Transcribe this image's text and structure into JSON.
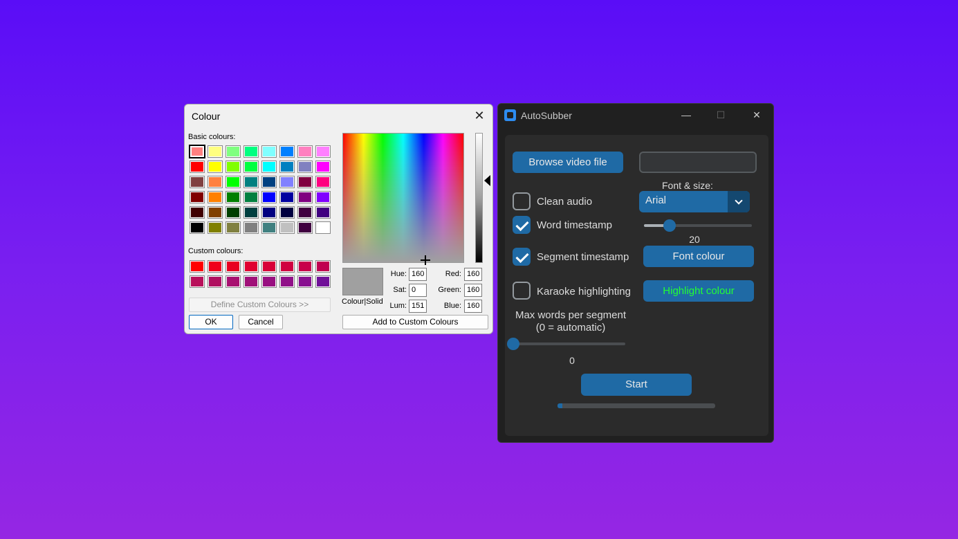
{
  "colour_dialog": {
    "title": "Colour",
    "basic_label": "Basic colours:",
    "custom_label": "Custom colours:",
    "basic_colours": [
      "#ff8080",
      "#ffff80",
      "#80ff80",
      "#00ff80",
      "#80ffff",
      "#0080ff",
      "#ff80c0",
      "#ff80ff",
      "#ff0000",
      "#ffff00",
      "#80ff00",
      "#00ff40",
      "#00ffff",
      "#0080c0",
      "#8080c0",
      "#ff00ff",
      "#804040",
      "#ff8040",
      "#00ff00",
      "#008080",
      "#004080",
      "#8080ff",
      "#800040",
      "#ff0080",
      "#800000",
      "#ff8000",
      "#008000",
      "#008040",
      "#0000ff",
      "#0000a0",
      "#800080",
      "#8000ff",
      "#400000",
      "#804000",
      "#004000",
      "#004040",
      "#000080",
      "#000040",
      "#400040",
      "#400080",
      "#000000",
      "#808000",
      "#808040",
      "#808080",
      "#408080",
      "#c0c0c0",
      "#400040",
      "#ffffff"
    ],
    "custom_colours": [
      "#ff0000",
      "#f0001a",
      "#e80020",
      "#e00030",
      "#d80038",
      "#d00040",
      "#c8004a",
      "#c00050",
      "#b8105a",
      "#b01060",
      "#a81070",
      "#a01078",
      "#981080",
      "#901088",
      "#881090",
      "#701098"
    ],
    "define_custom": "Define Custom Colours >>",
    "ok_label": "OK",
    "cancel_label": "Cancel",
    "add_custom": "Add to Custom Colours",
    "colour_solid": "Colour|Solid",
    "hue_label": "Hue:",
    "hue": "160",
    "sat_label": "Sat:",
    "sat": "0",
    "lum_label": "Lum:",
    "lum": "151",
    "red_label": "Red:",
    "red": "160",
    "green_label": "Green:",
    "green": "160",
    "blue_label": "Blue:",
    "blue": "160",
    "preview_colour": "#a0a0a0"
  },
  "app": {
    "title": "AutoSubber",
    "minimize": "—",
    "maximize": "☐",
    "close": "✕",
    "browse_label": "Browse video file",
    "file_path": "",
    "font_size_label": "Font & size:",
    "font_selected": "Arial",
    "font_size_value": "20",
    "font_size_fraction": 0.24,
    "clean_audio": {
      "label": "Clean audio",
      "checked": false
    },
    "word_timestamp": {
      "label": "Word timestamp",
      "checked": true
    },
    "segment_timestamp": {
      "label": "Segment timestamp",
      "checked": true
    },
    "karaoke": {
      "label": "Karaoke highlighting",
      "checked": false
    },
    "font_colour_label": "Font colour",
    "highlight_colour_label": "Highlight colour",
    "max_words_line1": "Max words per segment",
    "max_words_line2": "(0 = automatic)",
    "max_words_value": "0",
    "max_words_fraction": 0,
    "start_label": "Start",
    "progress_fraction": 0.03
  }
}
